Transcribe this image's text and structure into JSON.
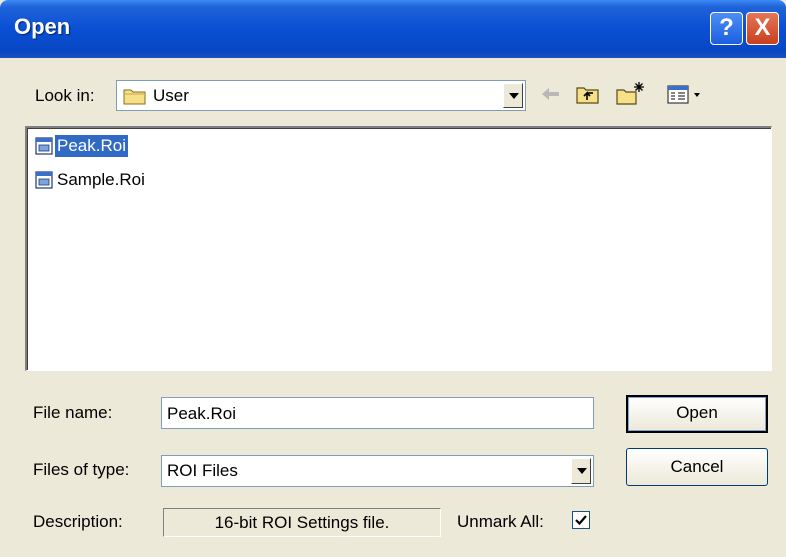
{
  "window": {
    "title": "Open"
  },
  "title_buttons": {
    "help": "?",
    "close": "X"
  },
  "look_in": {
    "label": "Look in:",
    "value": "User"
  },
  "toolbar": {
    "icons": [
      "back-arrow-icon",
      "up-folder-icon",
      "new-folder-icon",
      "view-menu-icon"
    ]
  },
  "files": [
    {
      "name": "Peak.Roi",
      "selected": true
    },
    {
      "name": "Sample.Roi",
      "selected": false
    }
  ],
  "file_name": {
    "label": "File name:",
    "value": "Peak.Roi"
  },
  "file_type": {
    "label": "Files of type:",
    "value": "ROI Files"
  },
  "description": {
    "label": "Description:",
    "value": "16-bit ROI Settings file."
  },
  "unmark_all": {
    "label": "Unmark All:",
    "checked": true
  },
  "buttons": {
    "open": "Open",
    "cancel": "Cancel"
  },
  "colors": {
    "title_bar": "#0a4fd4",
    "selection": "#316ac5",
    "dialog_bg": "#ece9d8"
  }
}
